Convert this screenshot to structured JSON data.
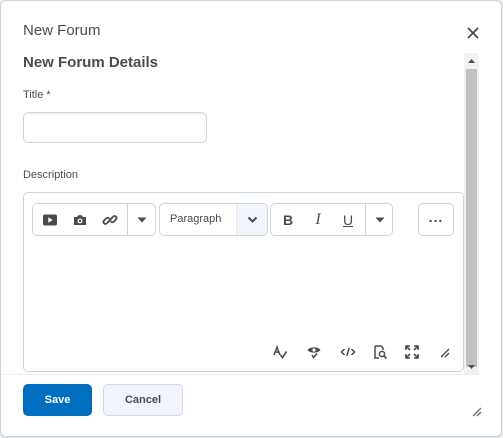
{
  "dialog": {
    "title": "New Forum"
  },
  "form": {
    "section_title": "New Forum Details",
    "title_label": "Title",
    "required_mark": "*",
    "title_value": "",
    "title_placeholder": "",
    "description_label": "Description"
  },
  "editor": {
    "toolbar": {
      "insert_group": [
        "video-icon",
        "camera-icon",
        "link-icon",
        "chevron-down-icon"
      ],
      "block_format": "Paragraph",
      "bold": "B",
      "italic": "I",
      "underline": "U",
      "more_label": "..."
    },
    "status_icons": [
      "spellcheck-icon",
      "accessibility-check-icon",
      "source-code-icon",
      "preview-icon",
      "fullscreen-icon",
      "editor-resize-icon"
    ]
  },
  "footer": {
    "save_label": "Save",
    "cancel_label": "Cancel"
  },
  "colors": {
    "primary": "#006fbf",
    "text": "#494c4e",
    "border": "#cdd5dc",
    "secondary_button_bg": "#f1f5fb"
  }
}
